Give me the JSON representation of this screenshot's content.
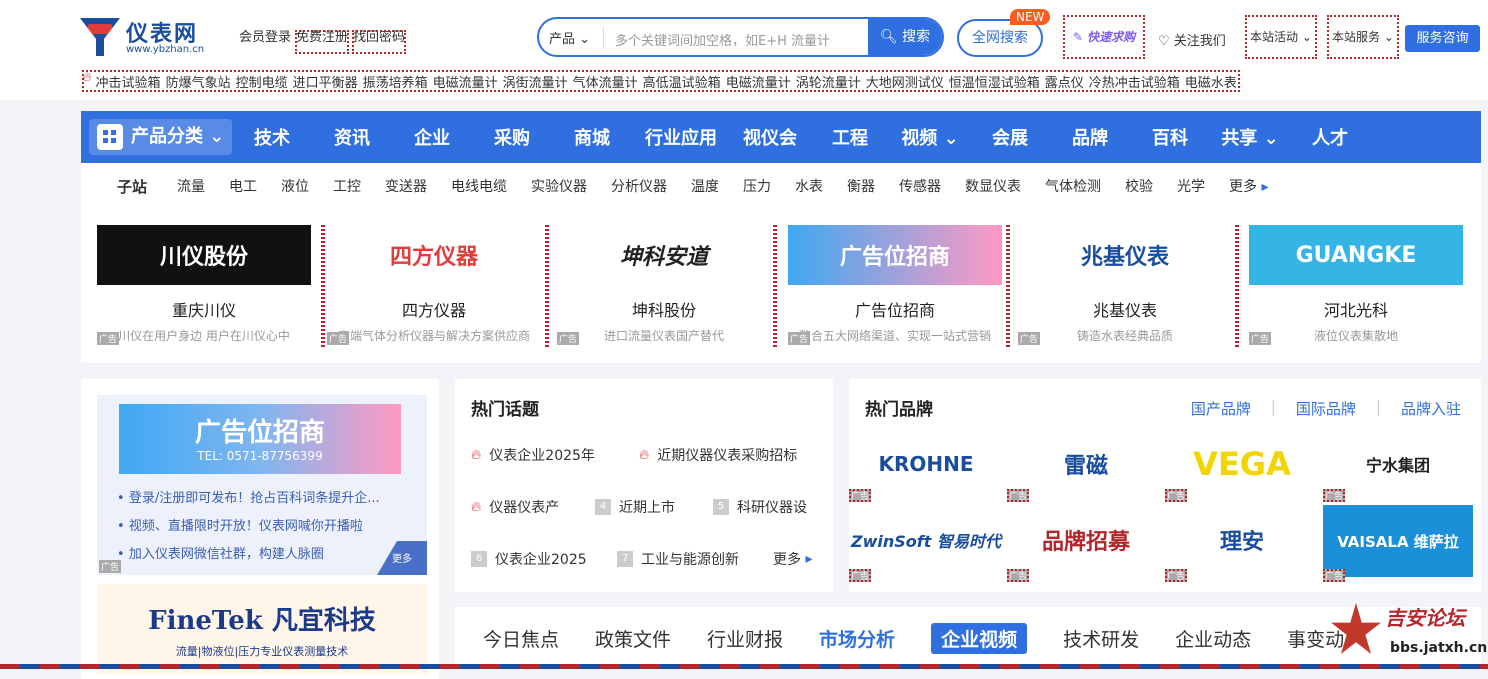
{
  "header": {
    "logo_cn": "仪表网",
    "logo_url": "www.ybzhan.cn",
    "top_links": [
      "会员登录",
      "免费注册",
      "找回密码"
    ],
    "search": {
      "category": "产品",
      "placeholder": "多个关键词间加空格，如E+H 流量计",
      "button": "搜索"
    },
    "full_search": "全网搜索",
    "new_badge": "NEW",
    "quick_buy": "快速求购",
    "follow": "关注我们",
    "activities": "本站活动",
    "services": "本站服务",
    "consult": "服务咨询"
  },
  "hot_keywords": [
    "冲击试验箱",
    "防爆气象站",
    "控制电缆",
    "进口平衡器",
    "振荡培养箱",
    "电磁流量计",
    "涡街流量计",
    "气体流量计",
    "高低温试验箱",
    "电磁流量计",
    "涡轮流量计",
    "大地网测试仪",
    "恒温恒湿试验箱",
    "露点仪",
    "冷热冲击试验箱",
    "电磁水表"
  ],
  "nav": {
    "category": "产品分类",
    "items": [
      "技术",
      "资讯",
      "企业",
      "采购",
      "商城",
      "行业应用",
      "视仪会",
      "工程",
      "视频",
      "会展",
      "品牌",
      "百科",
      "共享",
      "人才"
    ]
  },
  "subnav": {
    "lead": "子站",
    "items": [
      "流量",
      "电工",
      "液位",
      "工控",
      "变送器",
      "电线电缆",
      "实验仪器",
      "分析仪器",
      "温度",
      "压力",
      "水表",
      "衡器",
      "传感器",
      "数显仪表",
      "气体检测",
      "校验",
      "光学",
      "更多"
    ]
  },
  "ads": [
    {
      "logo": "川仪股份",
      "title": "重庆川仪",
      "desc": "川仪在用户身边 用户在川仪心中",
      "tag": "广告"
    },
    {
      "logo": "四方仪器",
      "title": "四方仪器",
      "desc": "高端气体分析仪器与解决方案供应商",
      "tag": "广告"
    },
    {
      "logo": "坤科安道",
      "title": "坤科股份",
      "desc": "进口流量仪表国产替代",
      "tag": "广告"
    },
    {
      "logo": "广告位招商",
      "title": "广告位招商",
      "desc": "整合五大网络渠道、实现一站式营销",
      "tag": "广告"
    },
    {
      "logo": "兆基仪表",
      "title": "兆基仪表",
      "desc": "铸造水表经典品质",
      "tag": "广告"
    },
    {
      "logo": "GUANGKE",
      "title": "河北光科",
      "desc": "液位仪表集散地",
      "tag": "广告"
    }
  ],
  "left_box": {
    "banner_title": "广告位招商",
    "banner_tel": "TEL: 0571-87756399",
    "items": [
      "登录/注册即可发布！抢占百科词条提升企...",
      "视频、直播限时开放！仪表网喊你开播啦",
      "加入仪表网微信社群，构建人脉圈"
    ],
    "more": "更多",
    "tag": "广告",
    "finetek_name": "FineTek 凡宜科技",
    "finetek_desc": "流量|物液位|压力专业仪表测量技术"
  },
  "hot_topics": {
    "title": "热门话题",
    "items": [
      {
        "n": "",
        "text": "仪表企业2025年"
      },
      {
        "n": "",
        "text": "近期仪器仪表采购招标"
      },
      {
        "n": "",
        "text": "仪器仪表产"
      },
      {
        "n": "4",
        "text": "近期上市"
      },
      {
        "n": "5",
        "text": "科研仪器设"
      },
      {
        "n": "6",
        "text": "仪表企业2025"
      },
      {
        "n": "7",
        "text": "工业与能源创新"
      }
    ],
    "more": "更多"
  },
  "hot_brands": {
    "title": "热门品牌",
    "links": [
      "国产品牌",
      "国际品牌",
      "品牌入驻"
    ],
    "logos": [
      "KROHNE",
      "雷磁",
      "VEGA",
      "宁水集团",
      "ZwinSoft 智易时代",
      "品牌招募",
      "理安",
      "VAISALA 维萨拉"
    ],
    "tag": "广告"
  },
  "tabs": {
    "items": [
      "今日焦点",
      "政策文件",
      "行业财报",
      "市场分析",
      "企业视频",
      "技术研发",
      "企业动态",
      "事变动"
    ],
    "selected": "企业视频"
  },
  "watermark": {
    "cn": "吉安论坛",
    "url": "bbs.jatxh.cn"
  }
}
